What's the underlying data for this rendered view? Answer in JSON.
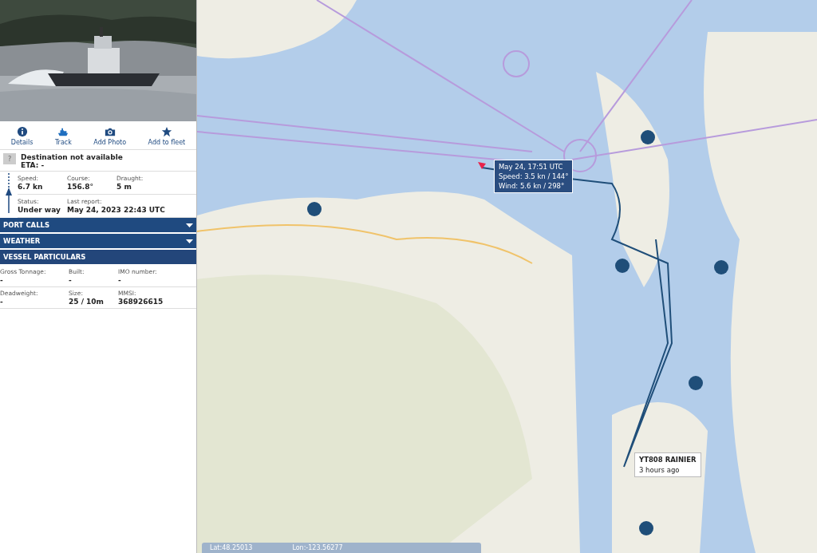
{
  "sidebar": {
    "photo": {
      "kind": "picture"
    },
    "actions": [
      {
        "label": "Details"
      },
      {
        "label": "Track"
      },
      {
        "label": "Add Photo"
      },
      {
        "label": "Add to fleet"
      }
    ],
    "destination": {
      "flag": "?",
      "title": "Destination not available",
      "eta": "ETA: -"
    },
    "voyage_rows": [
      [
        {
          "label": "Speed:",
          "value": "6.7 kn"
        },
        {
          "label": "Course:",
          "value": "156.8°"
        },
        {
          "label": "Draught:",
          "value": "5 m"
        }
      ],
      [
        {
          "label": "Status:",
          "value": "Under way"
        },
        {
          "label": "Last report:",
          "value": "May 24, 2023 22:43 UTC"
        }
      ]
    ],
    "sections": [
      {
        "title": "PORT CALLS",
        "expanded": false
      },
      {
        "title": "WEATHER",
        "expanded": false
      },
      {
        "title": "VESSEL PARTICULARS",
        "expanded": true
      }
    ],
    "particulars_rows": [
      [
        {
          "label": "Gross Tonnage:",
          "value": "-"
        },
        {
          "label": "Built:",
          "value": "-"
        },
        {
          "label": "IMO number:",
          "value": "-"
        }
      ],
      [
        {
          "label": "Deadweight:",
          "value": "-"
        },
        {
          "label": "Size:",
          "value": "25 / 10m"
        },
        {
          "label": "MMSI:",
          "value": "368926615"
        }
      ]
    ]
  },
  "map": {
    "kind": "picture",
    "position_tooltip": [
      "May 24, 17:51 UTC",
      "Speed: 3.5 kn / 144°",
      "Wind: 5.6 kn / 298°"
    ],
    "vessel_label": {
      "name": "YT808 RAINIER",
      "age": "3 hours ago"
    },
    "coordinates": {
      "lat": "Lat:48.25013",
      "lon": "Lon:-123.56277"
    }
  }
}
